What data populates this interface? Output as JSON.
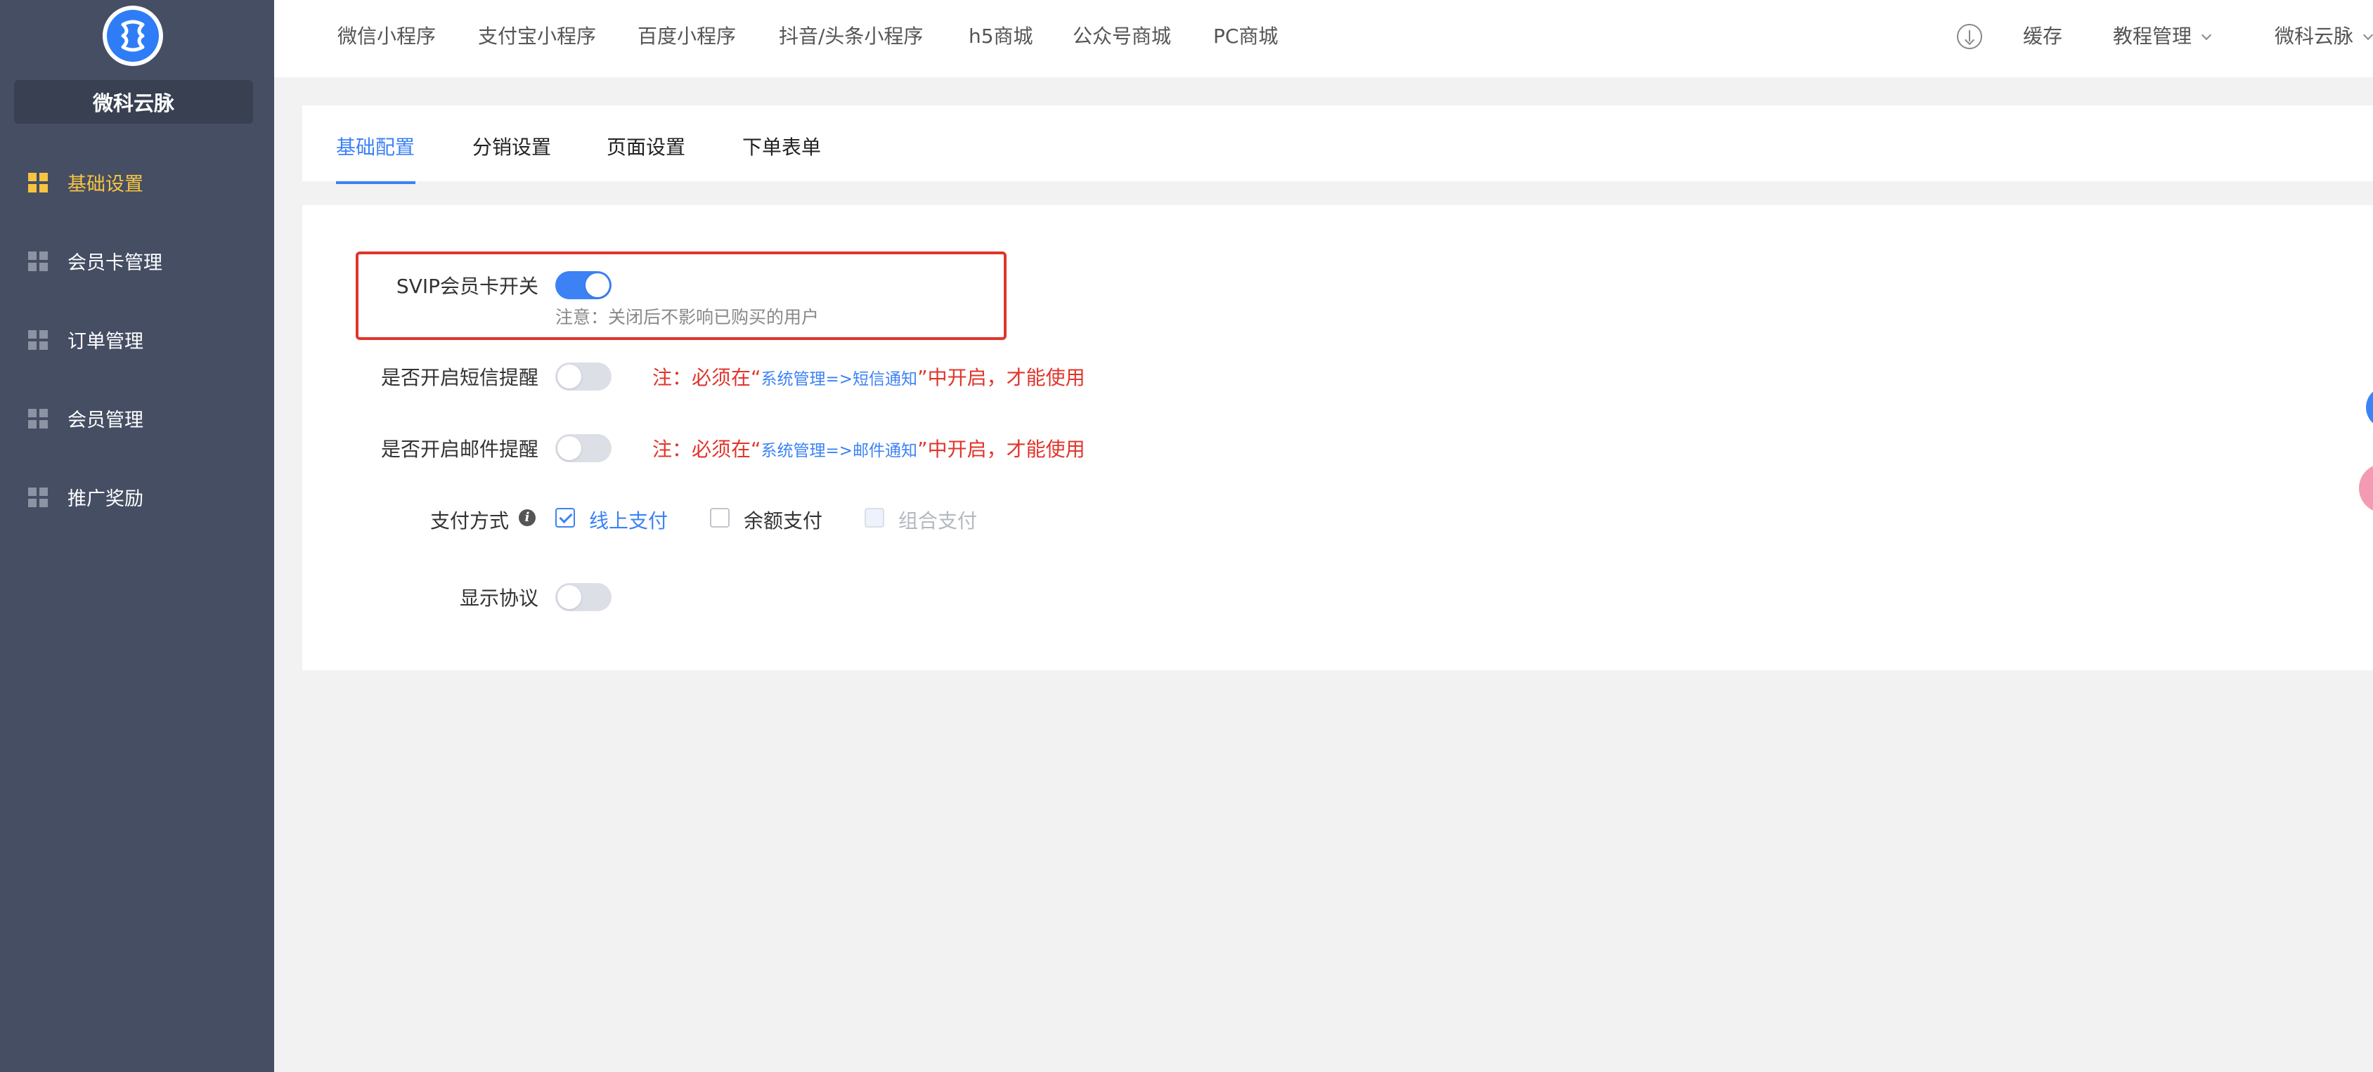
{
  "sidebar": {
    "brand": "微科云脉",
    "items": [
      {
        "label": "基础设置",
        "active": true
      },
      {
        "label": "会员卡管理",
        "active": false
      },
      {
        "label": "订单管理",
        "active": false
      },
      {
        "label": "会员管理",
        "active": false
      },
      {
        "label": "推广奖励",
        "active": false
      }
    ]
  },
  "topnav": {
    "links": [
      "微信小程序",
      "支付宝小程序",
      "百度小程序",
      "抖音/头条小程序",
      "h5商城",
      "公众号商城",
      "PC商城"
    ],
    "cache": "缓存",
    "tutorial": "教程管理",
    "user": "微科云脉"
  },
  "tabs": [
    "基础配置",
    "分销设置",
    "页面设置",
    "下单表单"
  ],
  "form": {
    "svip_label": "SVIP会员卡开关",
    "svip_on": true,
    "svip_note": "注意：关闭后不影响已购买的用户",
    "sms_label": "是否开启短信提醒",
    "sms_on": false,
    "sms_warn_pre": "注：必须在“",
    "sms_warn_link": "系统管理=>短信通知",
    "sms_warn_post": "”中开启，才能使用",
    "mail_label": "是否开启邮件提醒",
    "mail_on": false,
    "mail_warn_pre": "注：必须在“",
    "mail_warn_link": "系统管理=>邮件通知",
    "mail_warn_post": "”中开启，才能使用",
    "pay_label": "支付方式",
    "pay_options": [
      {
        "label": "线上支付",
        "checked": true,
        "disabled": false
      },
      {
        "label": "余额支付",
        "checked": false,
        "disabled": false
      },
      {
        "label": "组合支付",
        "checked": false,
        "disabled": true
      }
    ],
    "agreement_label": "显示协议",
    "agreement_on": false
  },
  "colors": {
    "sidebar_bg": "#454e63",
    "active_yellow": "#f7c441",
    "primary_blue": "#3c82f5",
    "warn_red": "#e0352b"
  },
  "icons": {
    "logo": "brand-logo-icon",
    "download": "download-icon",
    "nav": "grid-icon",
    "info": "info-icon"
  }
}
